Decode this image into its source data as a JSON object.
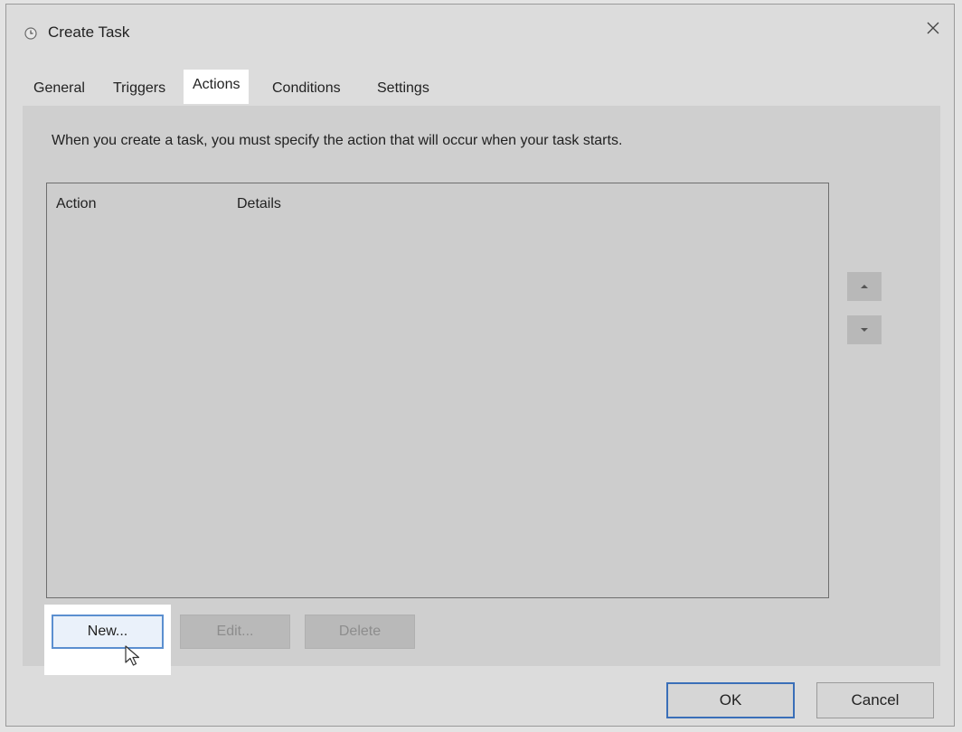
{
  "window": {
    "title": "Create Task",
    "icon": "clock-icon",
    "close_icon": "close-icon"
  },
  "tabs": [
    {
      "label": "General",
      "active": false
    },
    {
      "label": "Triggers",
      "active": false
    },
    {
      "label": "Actions",
      "active": true
    },
    {
      "label": "Conditions",
      "active": false
    },
    {
      "label": "Settings",
      "active": false
    }
  ],
  "actions_panel": {
    "instruction": "When you create a task, you must specify the action that will occur when your task starts.",
    "columns": [
      "Action",
      "Details"
    ],
    "rows": [],
    "move_up_icon": "arrow-up-icon",
    "move_down_icon": "arrow-down-icon",
    "buttons": {
      "new": "New...",
      "edit": "Edit...",
      "delete": "Delete"
    }
  },
  "footer": {
    "ok": "OK",
    "cancel": "Cancel"
  },
  "colors": {
    "accent": "#5b8fd0",
    "ok_border": "#3a6fb8",
    "panel_bg": "#cfcfcf"
  }
}
